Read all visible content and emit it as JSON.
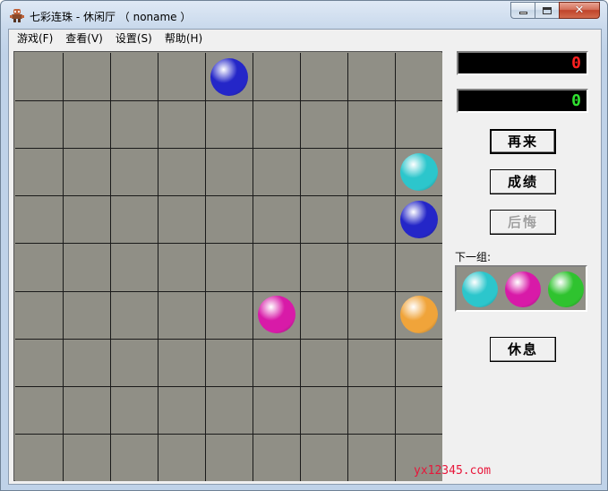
{
  "window": {
    "title": "七彩连珠 - 休闲厅 （ noname ）",
    "app_icon": "game-character-icon",
    "controls": {
      "minimize": "minimize-icon",
      "maximize": "maximize-icon",
      "close": "close-icon"
    }
  },
  "menu": [
    {
      "label": "游戏(F)"
    },
    {
      "label": "查看(V)"
    },
    {
      "label": "设置(S)"
    },
    {
      "label": "帮助(H)"
    }
  ],
  "board": {
    "rows": 9,
    "cols": 9,
    "background": "#908f86",
    "grid_line_color": "#1a1a1a",
    "balls": [
      {
        "row": 0,
        "col": 4,
        "color": "blue"
      },
      {
        "row": 2,
        "col": 8,
        "color": "cyan"
      },
      {
        "row": 3,
        "col": 8,
        "color": "blue"
      },
      {
        "row": 5,
        "col": 5,
        "color": "magenta"
      },
      {
        "row": 5,
        "col": 8,
        "color": "orange"
      }
    ],
    "ball_colors": {
      "blue": "#2426c8",
      "cyan": "#2cc6cc",
      "magenta": "#d81aa8",
      "orange": "#f0a43a",
      "green": "#2fc32f"
    }
  },
  "watermark": "yx12345.com",
  "scores": {
    "current": "0",
    "current_color": "#ff2020",
    "best": "0",
    "best_color": "#30e030"
  },
  "buttons": {
    "restart": "再来",
    "scores": "成绩",
    "undo": "后悔",
    "rest": "休息"
  },
  "next_group": {
    "label": "下一组:",
    "balls": [
      "cyan",
      "magenta",
      "green"
    ]
  }
}
